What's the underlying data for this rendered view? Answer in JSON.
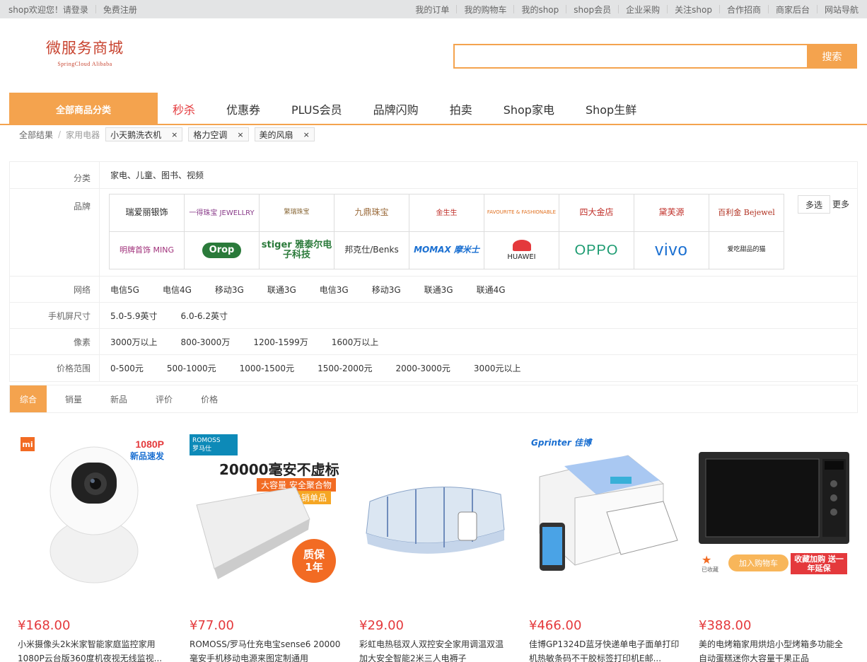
{
  "topbar": {
    "welcome": "shop欢迎您！请登录",
    "register": "免费注册",
    "links": [
      "我的订单",
      "我的购物车",
      "我的shop",
      "shop会员",
      "企业采购",
      "关注shop",
      "合作招商",
      "商家后台",
      "网站导航"
    ]
  },
  "logo": {
    "cn": "微服务商城",
    "en": "SpringCloud Alibaba"
  },
  "search": {
    "value": "",
    "button": "搜索"
  },
  "nav": {
    "category": "全部商品分类",
    "items": [
      "秒杀",
      "优惠券",
      "PLUS会员",
      "品牌闪购",
      "拍卖",
      "Shop家电",
      "Shop生鲜"
    ]
  },
  "crumbs": {
    "root": "全部结果",
    "current": "家用电器",
    "tags": [
      "小天鹅洗衣机",
      "格力空调",
      "美的风扇"
    ],
    "close_icon": "×"
  },
  "filters": {
    "category": {
      "label": "分类",
      "value": "家电、儿童、图书、视频"
    },
    "brand": {
      "label": "品牌",
      "multi": "多选",
      "more": "更多",
      "items": [
        "瑞爱丽银饰",
        "一得珠宝 JEWELLRY",
        "繁瑞珠宝",
        "九鼎珠宝",
        "金生生",
        "FAVOURITE & FASHIONABLE",
        "四大金店",
        "黛芙源",
        "百利金 Bejewel",
        "明牌首饰 MING",
        "Orop",
        "stiger 雅泰尔电子科技",
        "邦克仕/Benks",
        "MOMAX 摩米士",
        "HUAWEI",
        "OPPO",
        "vivo",
        "爱吃甜品的猫"
      ]
    },
    "network": {
      "label": "网络",
      "values": [
        "电信5G",
        "电信4G",
        "移动3G",
        "联通3G",
        "电信3G",
        "移动3G",
        "联通3G",
        "联通4G"
      ]
    },
    "screen": {
      "label": "手机屏尺寸",
      "values": [
        "5.0-5.9英寸",
        "6.0-6.2英寸"
      ]
    },
    "pixel": {
      "label": "像素",
      "values": [
        "3000万以上",
        "800-3000万",
        "1200-1599万",
        "1600万以上"
      ]
    },
    "price": {
      "label": "价格范围",
      "values": [
        "0-500元",
        "500-1000元",
        "1000-1500元",
        "1500-2000元",
        "2000-3000元",
        "3000元以上"
      ]
    }
  },
  "sort": [
    "综合",
    "销量",
    "新品",
    "评价",
    "价格"
  ],
  "products": [
    {
      "price": "¥168.00",
      "title": "小米摄像头2k米家智能家庭监控家用1080P云台版360度机夜视无线监视...",
      "badge1": "1080P",
      "badge2": "新品速发"
    },
    {
      "price": "¥77.00",
      "title": "ROMOSS/罗马仕充电宝sense6 20000毫安手机移动电源来图定制通用",
      "headline": "20000毫安不虚标",
      "sub": "大容量 安全聚合物",
      "hot": "热销单品",
      "stamp1": "质保",
      "stamp2": "1年",
      "brand": "ROMOSS",
      "brand_cn": "罗马仕"
    },
    {
      "price": "¥29.00",
      "title": "彩虹电热毯双人双控安全家用调温双温加大安全智能2米三人电褥子"
    },
    {
      "price": "¥466.00",
      "title": "佳博GP1324D蓝牙快递单电子面单打印机热敏条码不干胶标签打印机E邮...",
      "brand": "Gprinter 佳博"
    },
    {
      "price": "¥388.00",
      "title": "美的电烤箱家用烘焙小型烤箱多功能全自动蛋糕迷你大容量干果正品",
      "cart": "加入购物车",
      "promo": "收藏加购 送一年延保",
      "fav": "已收藏"
    }
  ],
  "colors": {
    "accent": "#f4a34e",
    "price": "#e4393c"
  }
}
